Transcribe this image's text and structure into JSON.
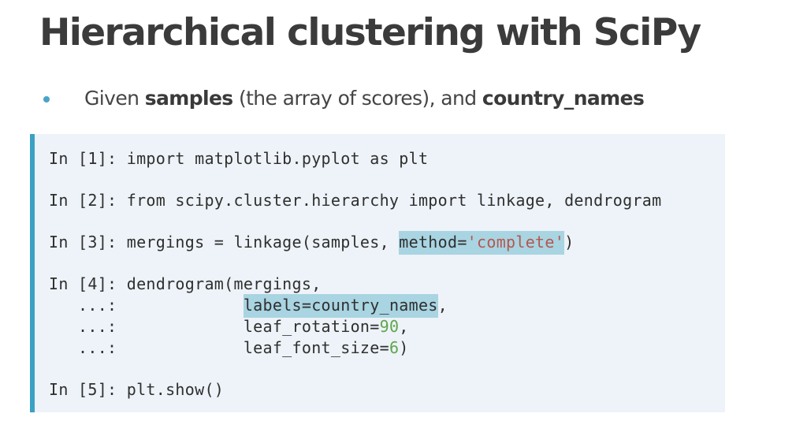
{
  "slide": {
    "title": "Hierarchical clustering with SciPy"
  },
  "bullet": {
    "prefix": "Given ",
    "samples": "samples",
    "middle": " (the array of scores), and ",
    "country_names": "country_names"
  },
  "code": {
    "line1": "In [1]: import matplotlib.pyplot as plt",
    "line2": "In [2]: from scipy.cluster.hierarchy import linkage, dendrogram",
    "line3_pre": "In [3]: mergings = linkage(samples, ",
    "line3_hl_key": "method=",
    "line3_hl_str": "'complete'",
    "line3_post": ")",
    "line4": "In [4]: dendrogram(mergings,",
    "line5_pre": "   ...:             ",
    "line5_hl": "labels=country_names",
    "line5_post": ",",
    "line6_pre": "   ...:             leaf_rotation=",
    "line6_num": "90",
    "line6_post": ",",
    "line7_pre": "   ...:             leaf_font_size=",
    "line7_num": "6",
    "line7_post": ")",
    "line8": "In [5]: plt.show()"
  },
  "colors": {
    "accent": "#3aa0c4",
    "highlight": "#a9d4e2",
    "string": "#b5574f",
    "number": "#5fa64b",
    "panel_bg": "#edf3f8"
  }
}
